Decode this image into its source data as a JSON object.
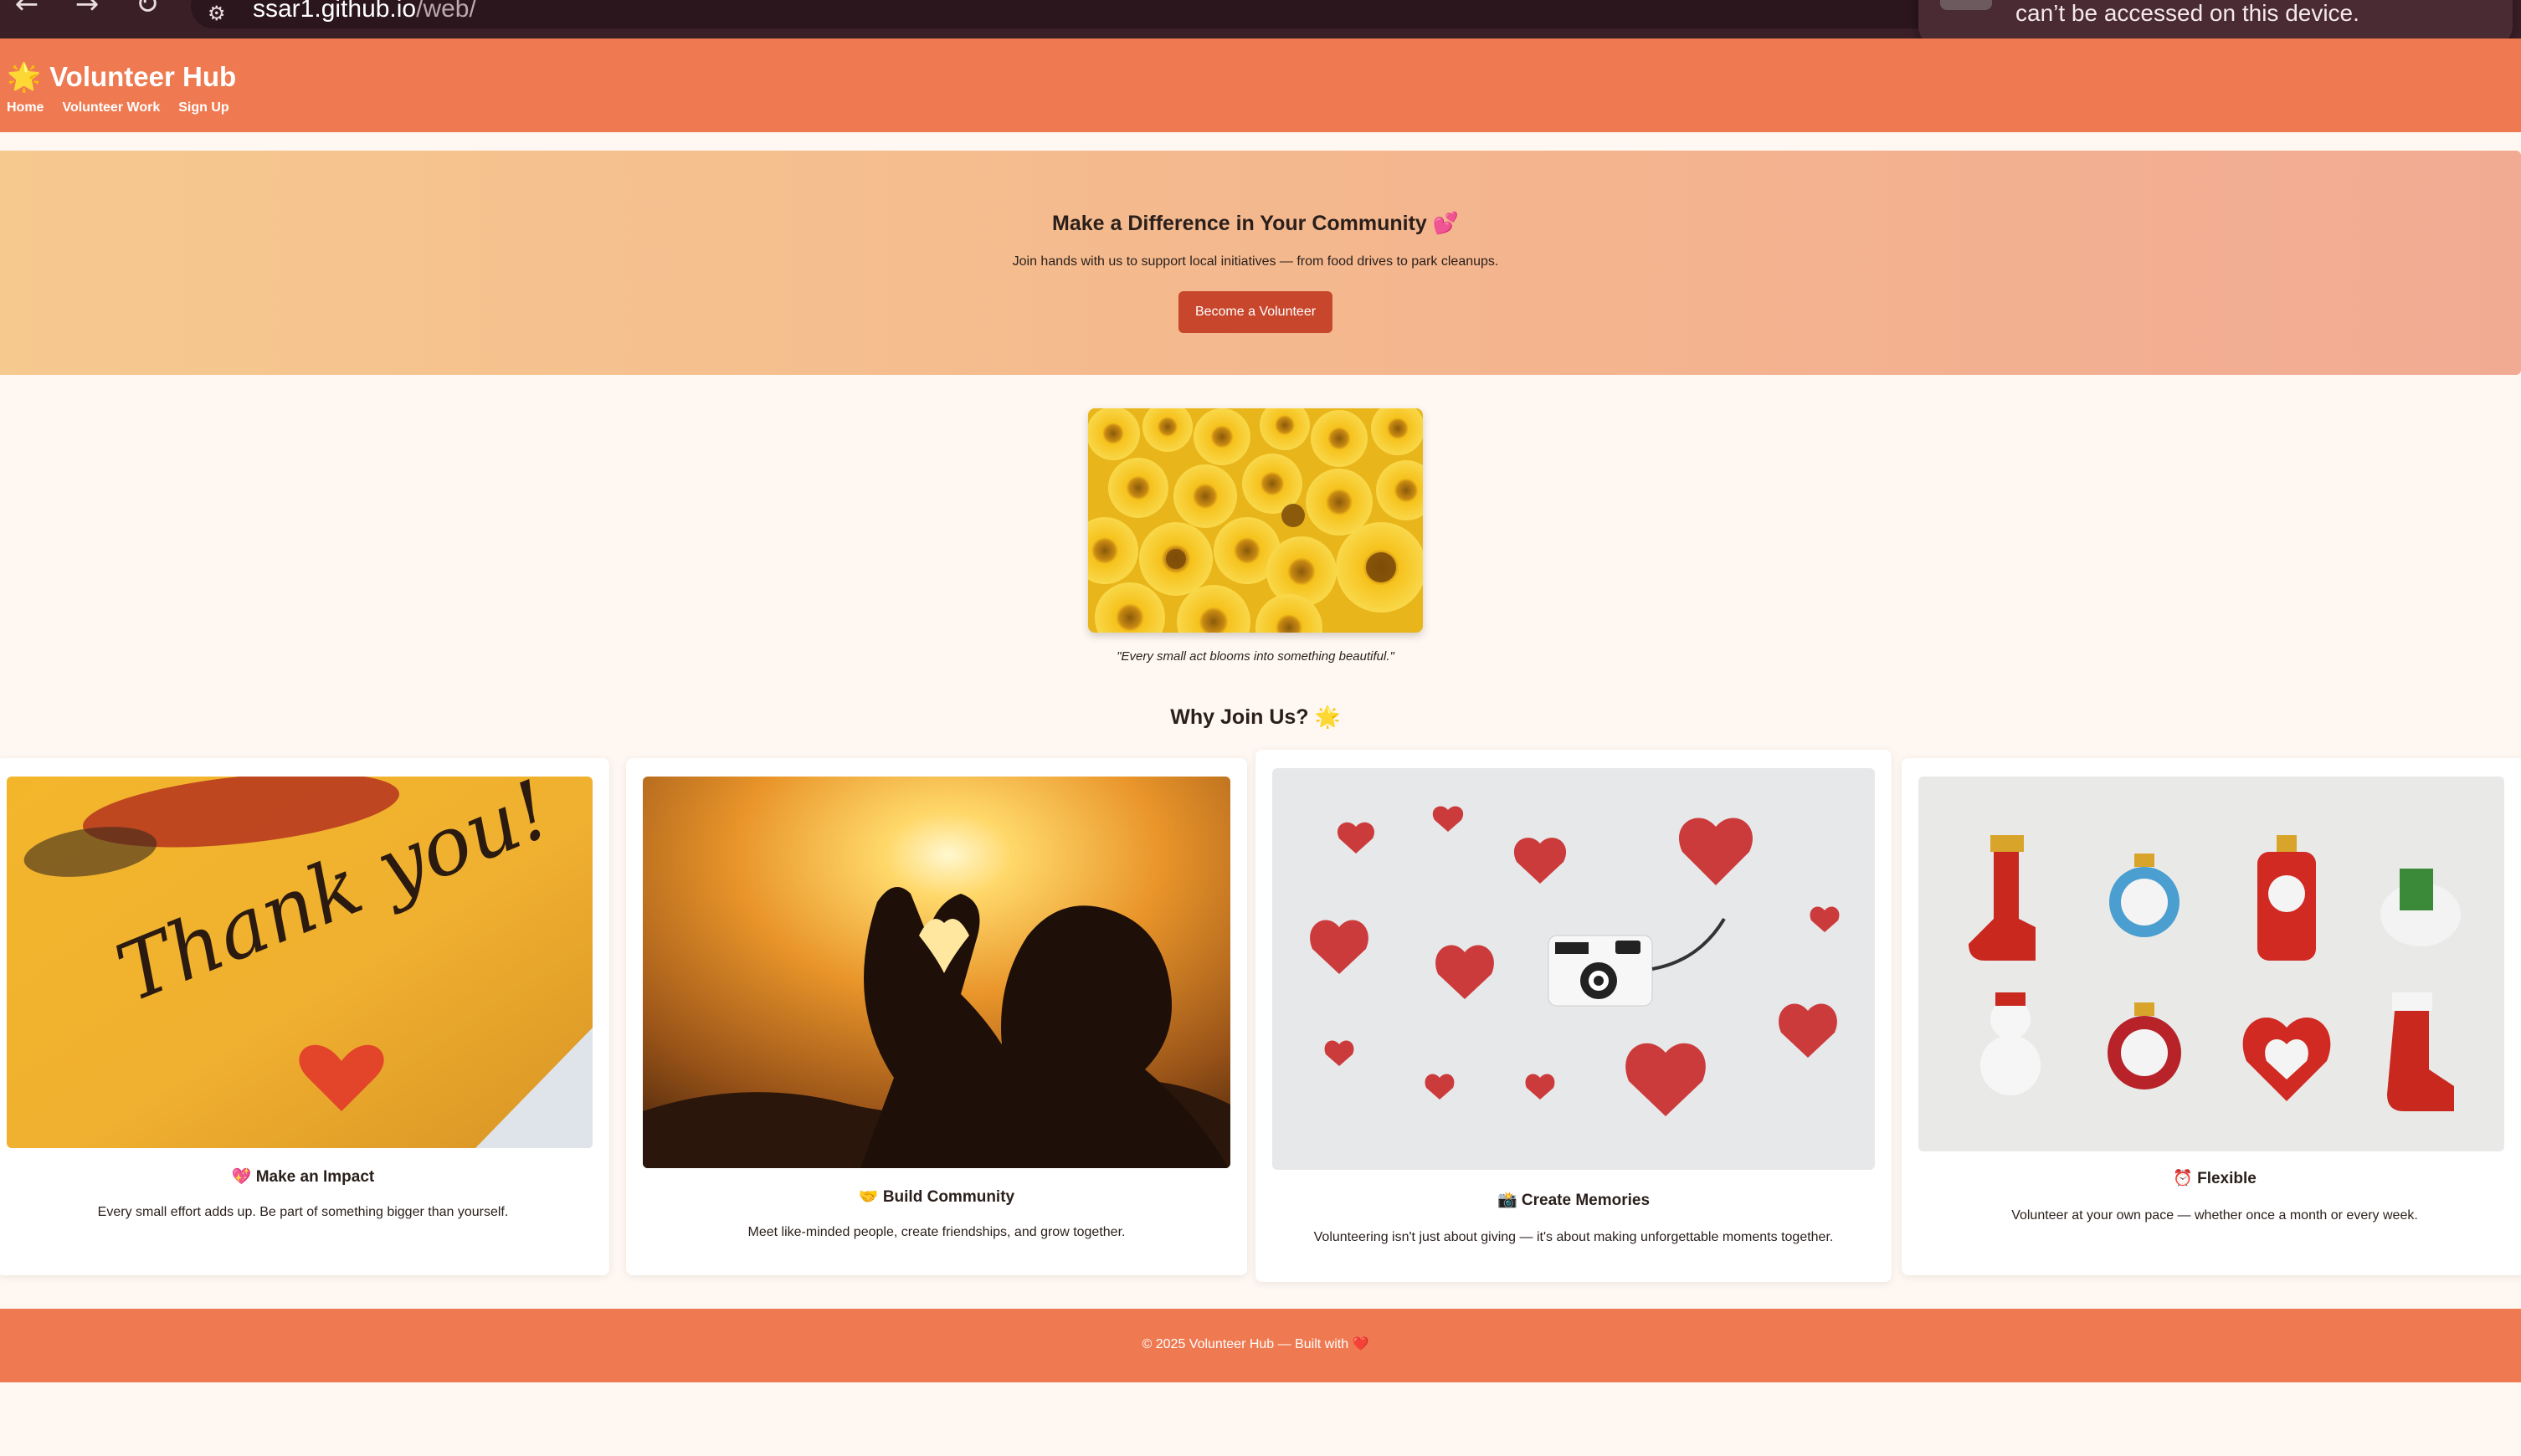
{
  "browser": {
    "url_host": "ssar1.github.io",
    "url_path": "/web/",
    "toast_text": "can’t be accessed on this device."
  },
  "header": {
    "brand_icon": "🌟",
    "brand_name": "Volunteer Hub",
    "nav": [
      "Home",
      "Volunteer Work",
      "Sign Up"
    ]
  },
  "hero": {
    "title": "Make a Difference in Your Community",
    "title_emoji": "💕",
    "subtitle": "Join hands with us to support local initiatives — from food drives to park cleanups.",
    "button_label": "Become a Volunteer"
  },
  "feature": {
    "caption": "\"Every small act blooms into something beautiful.\""
  },
  "why": {
    "title": "Why Join Us?",
    "title_emoji": "🌟"
  },
  "cards": [
    {
      "emoji": "💖",
      "title": "Make an Impact",
      "description": "Every small effort adds up. Be part of something bigger than yourself.",
      "image_text": "Thank you!"
    },
    {
      "emoji": "🤝",
      "title": "Build Community",
      "description": "Meet like-minded people, create friendships, and grow together."
    },
    {
      "emoji": "📸",
      "title": "Create Memories",
      "description": "Volunteering isn't just about giving — it's about making unforgettable moments together."
    },
    {
      "emoji": "⏰",
      "title": "Flexible",
      "description": "Volunteer at your own pace — whether once a month or every week."
    }
  ],
  "footer": {
    "text": "© 2025 Volunteer Hub — Built with",
    "heart": "❤️"
  },
  "colors": {
    "header": "#ef7a51",
    "button": "#c8472c",
    "page_bg": "#fff7f1"
  }
}
